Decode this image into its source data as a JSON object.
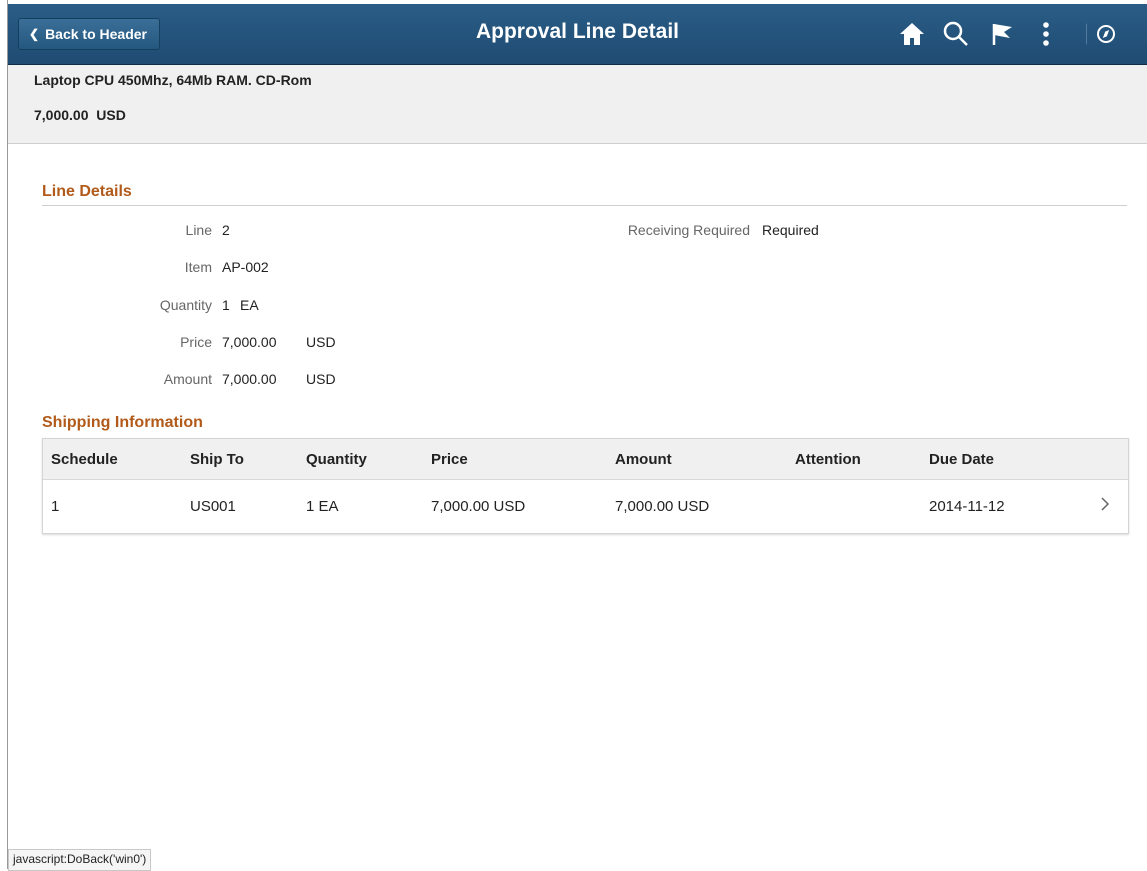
{
  "header": {
    "back_label": "Back to Header",
    "title": "Approval Line Detail",
    "icons": [
      "home-icon",
      "search-icon",
      "flag-icon",
      "more-icon",
      "navbar-icon"
    ],
    "bg_color": "#1f4b72"
  },
  "summary": {
    "description": "Laptop CPU 450Mhz, 64Mb RAM. CD-Rom",
    "amount": "7,000.00",
    "currency": "USD"
  },
  "line_details": {
    "title": "Line Details",
    "line_label": "Line",
    "line_value": "2",
    "item_label": "Item",
    "item_value": "AP-002",
    "quantity_label": "Quantity",
    "quantity_value": "1",
    "quantity_uom": "EA",
    "price_label": "Price",
    "price_value": "7,000.00",
    "price_currency": "USD",
    "amount_label": "Amount",
    "amount_value": "7,000.00",
    "amount_currency": "USD",
    "receiving_label": "Receiving Required",
    "receiving_value": "Required"
  },
  "shipping": {
    "title": "Shipping Information",
    "columns": [
      "Schedule",
      "Ship To",
      "Quantity",
      "Price",
      "Amount",
      "Attention",
      "Due Date"
    ],
    "rows": [
      {
        "schedule": "1",
        "ship_to": "US001",
        "quantity": "1 EA",
        "price": "7,000.00 USD",
        "amount": "7,000.00 USD",
        "attention": "",
        "due_date": "2014-11-12"
      }
    ]
  },
  "status_bar": "javascript:DoBack('win0')",
  "colors": {
    "section_title": "#b25a1a",
    "header": "#1f4b72"
  }
}
